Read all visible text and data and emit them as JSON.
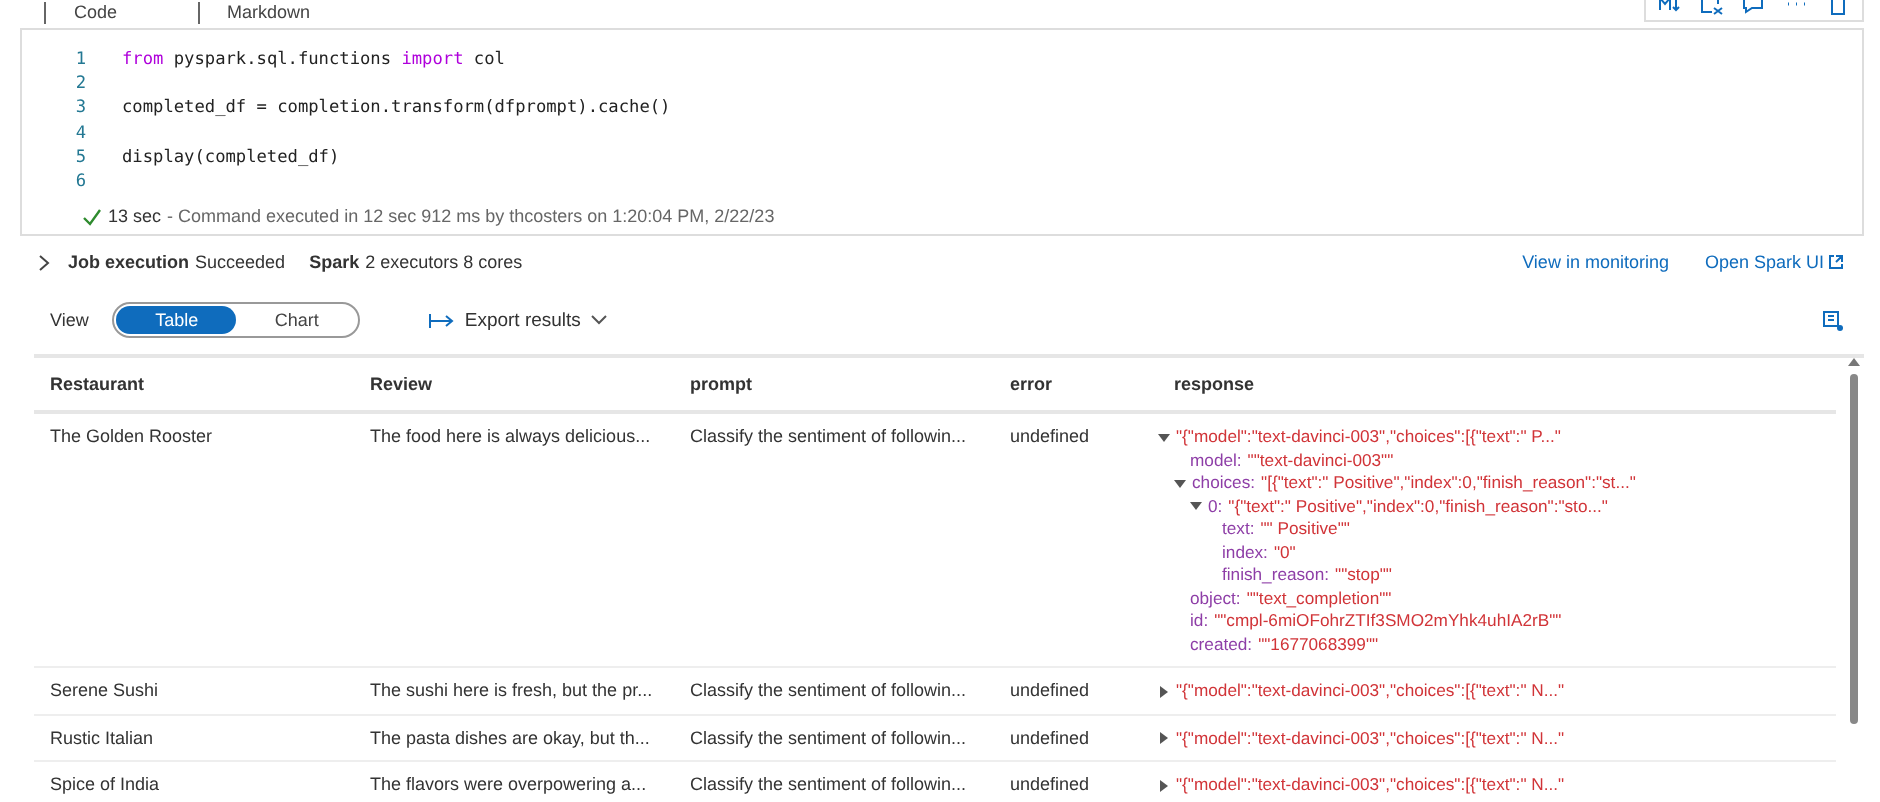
{
  "cell_tabs": [
    {
      "label": "Code"
    },
    {
      "label": "Markdown"
    }
  ],
  "code": {
    "lines": [
      {
        "number": "1",
        "tokens": [
          {
            "text": "from",
            "kind": "keyword"
          },
          {
            "text": " pyspark.sql.functions ",
            "kind": "plain"
          },
          {
            "text": "import",
            "kind": "keyword"
          },
          {
            "text": " col",
            "kind": "plain"
          }
        ]
      },
      {
        "number": "2"
      },
      {
        "number": "3",
        "tokens": [
          {
            "text": "completed_df = completion.transform(dfprompt).cache()",
            "kind": "plain"
          }
        ]
      },
      {
        "number": "4"
      },
      {
        "number": "5",
        "tokens": [
          {
            "text": "display(completed_df)",
            "kind": "plain"
          }
        ]
      },
      {
        "number": "6"
      }
    ],
    "status": {
      "succeeded": true,
      "duration": "13 sec",
      "detail": "- Command executed in 12 sec 912 ms by thcosters on 1:20:04 PM, 2/22/23"
    }
  },
  "job": {
    "expanded": false,
    "label": "Job execution",
    "state": "Succeeded",
    "spark_label": "Spark",
    "spark_info": "2 executors 8 cores",
    "links": [
      "View in monitoring",
      "Open Spark UI"
    ]
  },
  "view": {
    "label": "View",
    "options": [
      {
        "label": "Table",
        "selected": true
      },
      {
        "label": "Chart",
        "selected": false
      }
    ],
    "export": "Export results"
  },
  "table": {
    "columns": [
      "Restaurant",
      "Review",
      "prompt",
      "error",
      "response"
    ],
    "rows": [
      {
        "cells": [
          "The Golden Rooster",
          "The food here is always delicious...",
          "Classify the sentiment of followin...",
          "undefined"
        ],
        "response": {
          "value": "\"{\"model\":\"text-davinci-003\",\"choices\":[{\"text\":\" P...\"",
          "expanded": true,
          "children": [
            {
              "key": "model:",
              "value": "\"\"text-davinci-003\"\""
            },
            {
              "key": "choices:",
              "value": "\"[{\"text\":\" Positive\",\"index\":0,\"finish_reason\":\"st...\"",
              "expanded": true,
              "children": [
                {
                  "key": "0:",
                  "value": "\"{\"text\":\" Positive\",\"index\":0,\"finish_reason\":\"sto...\"",
                  "expanded": true,
                  "children": [
                    {
                      "key": "text:",
                      "value": "\"\" Positive\"\""
                    },
                    {
                      "key": "index:",
                      "value": "\"0\""
                    },
                    {
                      "key": "finish_reason:",
                      "value": "\"\"stop\"\""
                    }
                  ]
                }
              ]
            },
            {
              "key": "object:",
              "value": "\"\"text_completion\"\""
            },
            {
              "key": "id:",
              "value": "\"\"cmpl-6miOFohrZTIf3SMO2mYhk4uhIA2rB\"\""
            },
            {
              "key": "created:",
              "value": "\"\"1677068399\"\""
            }
          ]
        }
      },
      {
        "cells": [
          "Serene Sushi",
          "The sushi here is fresh, but the pr...",
          "Classify the sentiment of followin...",
          "undefined"
        ],
        "response": {
          "value": "\"{\"model\":\"text-davinci-003\",\"choices\":[{\"text\":\" N...\"",
          "expanded": false
        }
      },
      {
        "cells": [
          "Rustic Italian",
          "The pasta dishes are okay, but th...",
          "Classify the sentiment of followin...",
          "undefined"
        ],
        "response": {
          "value": "\"{\"model\":\"text-davinci-003\",\"choices\":[{\"text\":\" N...\"",
          "expanded": false
        }
      },
      {
        "cells": [
          "Spice of India",
          "The flavors were overpowering a...",
          "Classify the sentiment of followin...",
          "undefined"
        ],
        "response": {
          "value": "\"{\"model\":\"text-davinci-003\",\"choices\":[{\"text\":\" N...\"",
          "expanded": false
        }
      }
    ]
  }
}
